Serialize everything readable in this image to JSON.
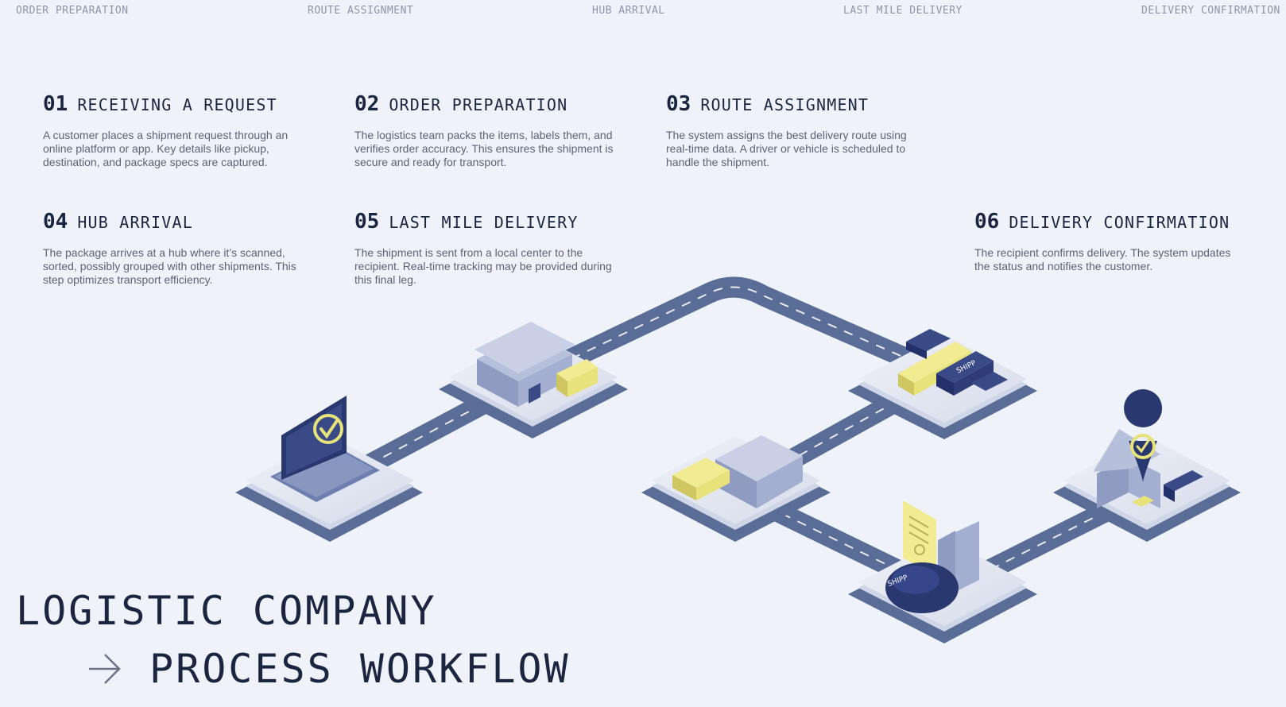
{
  "nav": [
    "ORDER PREPARATION",
    "ROUTE ASSIGNMENT",
    "HUB ARRIVAL",
    "LAST MILE DELIVERY",
    "DELIVERY CONFIRMATION"
  ],
  "steps": [
    {
      "number": "01",
      "title": "RECEIVING A REQUEST",
      "description": "A customer places a shipment request through an online platform or app. Key details like pickup, destination, and package specs are captured."
    },
    {
      "number": "02",
      "title": "ORDER PREPARATION",
      "description": "The logistics team packs the items, labels them, and verifies order accuracy. This ensures the shipment is secure and ready for transport."
    },
    {
      "number": "03",
      "title": "ROUTE ASSIGNMENT",
      "description": "The system assigns the best delivery route using real-time data. A driver or vehicle is scheduled to handle the shipment."
    },
    {
      "number": "04",
      "title": "HUB ARRIVAL",
      "description": "The package arrives at a hub where it’s scanned, sorted, possibly grouped with other shipments. This step optimizes transport efficiency."
    },
    {
      "number": "05",
      "title": "LAST MILE DELIVERY",
      "description": "The shipment is sent from a local center to the recipient. Real-time tracking may be provided during this final leg."
    },
    {
      "number": "06",
      "title": "DELIVERY CONFIRMATION",
      "description": "The recipient confirms delivery. The system updates the status and notifies the customer."
    }
  ],
  "title": {
    "line1": "LOGISTIC COMPANY",
    "line2": "PROCESS WORKFLOW"
  },
  "brand_label": "SHIPP",
  "colors": {
    "background": "#eff2f9",
    "road": "#5a6d96",
    "platform": "#dde3f1",
    "platform_dark": "#5a6d96",
    "accent_yellow": "#e8e27a",
    "navy": "#2a3870",
    "text": "#1b2540"
  }
}
